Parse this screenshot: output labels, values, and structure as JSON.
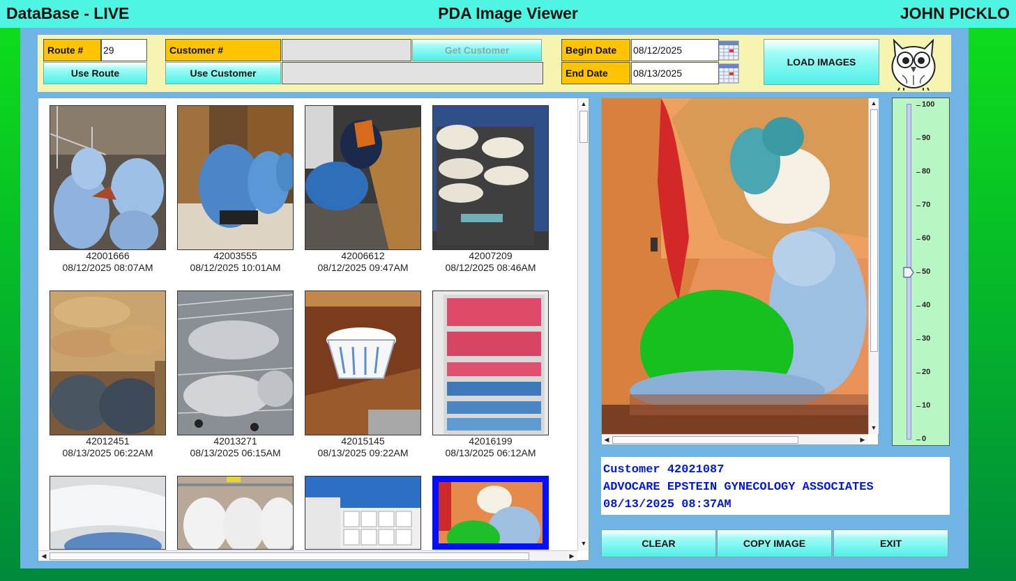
{
  "titlebar": {
    "left": "DataBase - LIVE",
    "center": "PDA Image Viewer",
    "right": "JOHN PICKLO"
  },
  "toolbar": {
    "route_label": "Route #",
    "route_value": "29",
    "use_route": "Use Route",
    "customer_label": "Customer #",
    "customer_value": "",
    "customer_name_value": "",
    "get_customer": "Get Customer",
    "use_customer": "Use Customer",
    "begin_date_label": "Begin Date",
    "begin_date_value": "08/12/2025",
    "end_date_label": "End Date",
    "end_date_value": "08/13/2025",
    "load_images": "LOAD IMAGES"
  },
  "gallery": {
    "items": [
      {
        "id": "42001666",
        "ts": "08/12/2025 08:07AM"
      },
      {
        "id": "42003555",
        "ts": "08/12/2025 10:01AM"
      },
      {
        "id": "42006612",
        "ts": "08/12/2025 09:47AM"
      },
      {
        "id": "42007209",
        "ts": "08/12/2025 08:46AM"
      },
      {
        "id": "42012451",
        "ts": "08/13/2025 06:22AM"
      },
      {
        "id": "42013271",
        "ts": "08/13/2025 06:15AM"
      },
      {
        "id": "42015145",
        "ts": "08/13/2025 09:22AM"
      },
      {
        "id": "42016199",
        "ts": "08/13/2025 06:12AM"
      }
    ]
  },
  "zoom_slider": {
    "ticks": [
      "100",
      "90",
      "80",
      "70",
      "60",
      "50",
      "40",
      "30",
      "20",
      "10",
      "0"
    ],
    "value": 50
  },
  "info": {
    "customer_line": "Customer 42021087",
    "name_line": "ADVOCARE EPSTEIN GYNECOLOGY ASSOCIATES",
    "ts_line": "08/13/2025 08:37AM"
  },
  "footer": {
    "clear": "CLEAR",
    "copy_image": "COPY IMAGE",
    "exit": "EXIT"
  }
}
